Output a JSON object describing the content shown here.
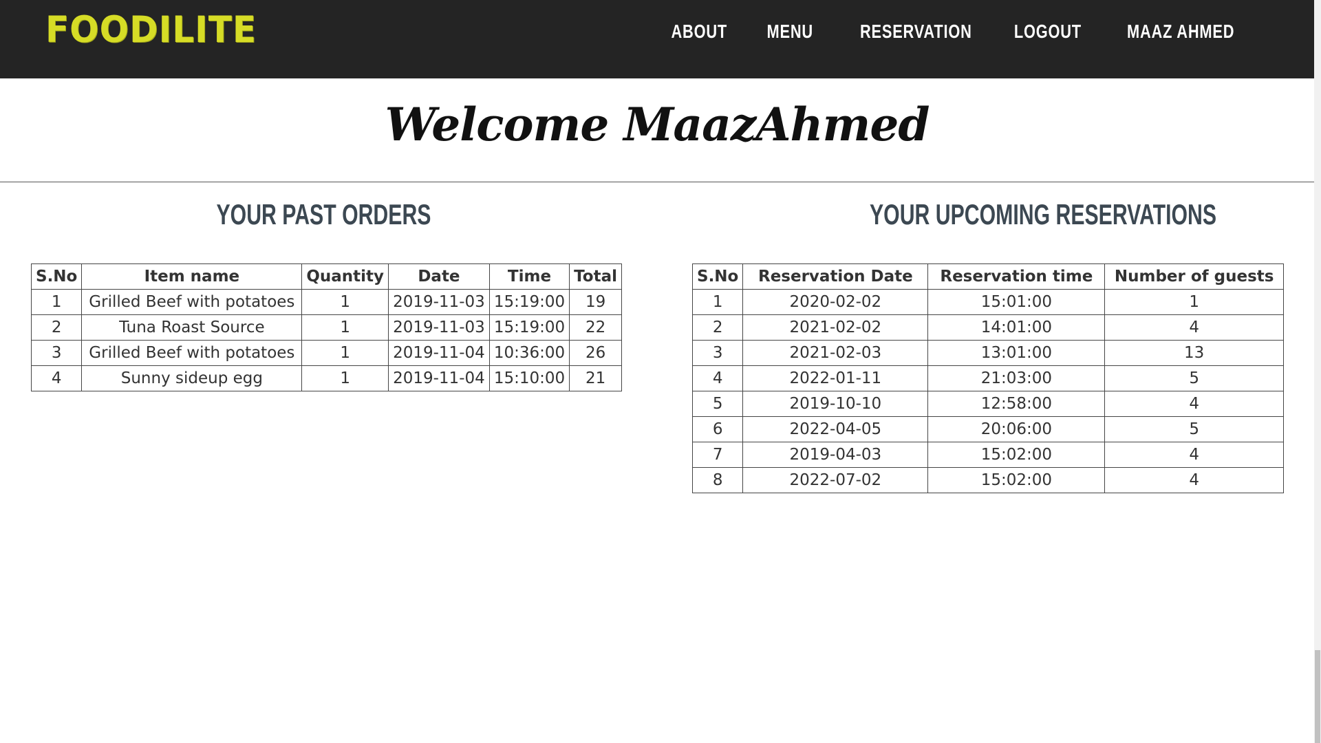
{
  "brand": {
    "logo_text": "FOODILITE",
    "logo_color": "#d6dc26",
    "nav_bg": "#242424"
  },
  "nav": {
    "items": [
      {
        "label": "ABOUT"
      },
      {
        "label": "MENU"
      },
      {
        "label": "RESERVATION"
      },
      {
        "label": "LOGOUT"
      },
      {
        "label": "MAAZ AHMED"
      }
    ]
  },
  "welcome": {
    "text": "Welcome MaazAhmed"
  },
  "past_orders": {
    "title": "YOUR PAST ORDERS",
    "headers": [
      "S.No",
      "Item name",
      "Quantity",
      "Date",
      "Time",
      "Total"
    ],
    "rows": [
      [
        "1",
        "Grilled Beef with potatoes",
        "1",
        "2019-11-03",
        "15:19:00",
        "19"
      ],
      [
        "2",
        "Tuna Roast Source",
        "1",
        "2019-11-03",
        "15:19:00",
        "22"
      ],
      [
        "3",
        "Grilled Beef with potatoes",
        "1",
        "2019-11-04",
        "10:36:00",
        "26"
      ],
      [
        "4",
        "Sunny sideup egg",
        "1",
        "2019-11-04",
        "15:10:00",
        "21"
      ]
    ]
  },
  "reservations": {
    "title": "YOUR UPCOMING RESERVATIONS",
    "headers": [
      "S.No",
      "Reservation Date",
      "Reservation time",
      "Number of guests"
    ],
    "rows": [
      [
        "1",
        "2020-02-02",
        "15:01:00",
        "1"
      ],
      [
        "2",
        "2021-02-02",
        "14:01:00",
        "4"
      ],
      [
        "3",
        "2021-02-03",
        "13:01:00",
        "13"
      ],
      [
        "4",
        "2022-01-11",
        "21:03:00",
        "5"
      ],
      [
        "5",
        "2019-10-10",
        "12:58:00",
        "4"
      ],
      [
        "6",
        "2022-04-05",
        "20:06:00",
        "5"
      ],
      [
        "7",
        "2019-04-03",
        "15:02:00",
        "4"
      ],
      [
        "8",
        "2022-07-02",
        "15:02:00",
        "4"
      ]
    ]
  }
}
